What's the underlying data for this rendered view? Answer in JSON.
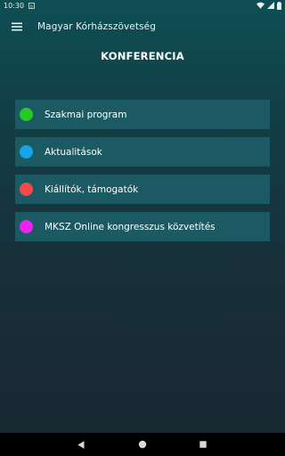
{
  "status_bar": {
    "time": "10:30",
    "icons": [
      "notification-icon",
      "wifi-icon",
      "signal-icon",
      "battery-icon"
    ]
  },
  "app_bar": {
    "title": "Magyar Kórházszövetség",
    "menu_icon": "hamburger-menu-icon"
  },
  "section_title": "KONFERENCIA",
  "menu_items": [
    {
      "label": "Szakmai program",
      "color": "#22cc22"
    },
    {
      "label": "Aktualitások",
      "color": "#12a7e8"
    },
    {
      "label": "Kiállítók, támogatók",
      "color": "#f24a4a"
    },
    {
      "label": "MKSZ Online kongresszus közvetítés",
      "color": "#ee22ee"
    }
  ],
  "colors": {
    "item_background": "#1b5a63",
    "status_bar": "#0f4d54",
    "nav_bar": "#000000"
  },
  "nav_bar": {
    "icons": [
      "back-icon",
      "home-icon",
      "recents-icon"
    ]
  }
}
